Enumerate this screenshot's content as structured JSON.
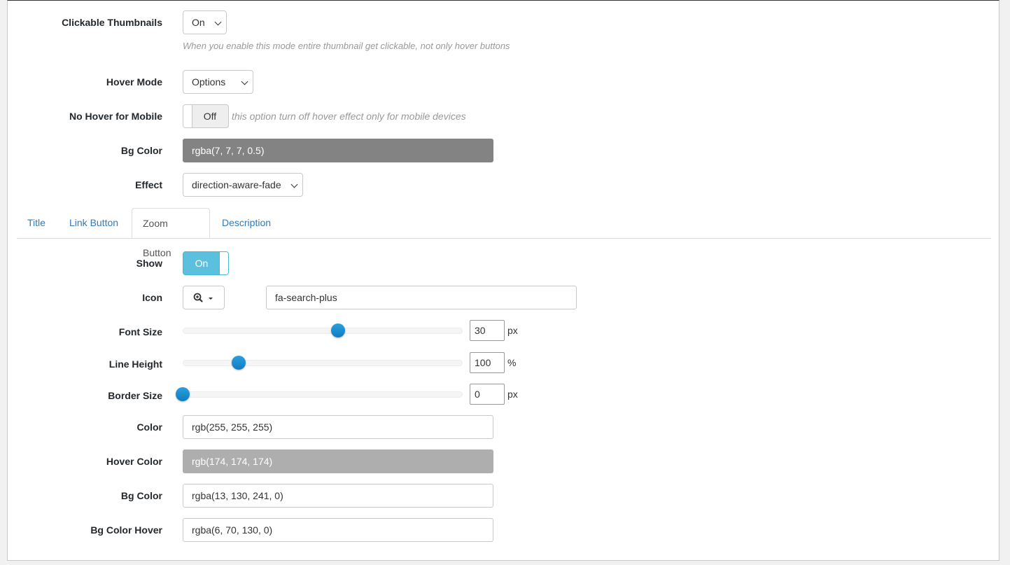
{
  "thumbnails": {
    "clickable_label": "Clickable Thumbnails",
    "clickable_value": "On",
    "clickable_hint": "When you enable this mode entire thumbnail get clickable, not only hover buttons",
    "hover_mode_label": "Hover Mode",
    "hover_mode_value": "Options",
    "no_hover_label": "No Hover for Mobile",
    "no_hover_value": "Off",
    "no_hover_hint": "this option turn off hover effect only for mobile devices",
    "bg_color_label": "Bg Color",
    "bg_color_value": "rgba(7, 7, 7, 0.5)",
    "effect_label": "Effect",
    "effect_value": "direction-aware-fade"
  },
  "tabs": [
    {
      "label": "Title",
      "active": false
    },
    {
      "label": "Link Button",
      "active": false
    },
    {
      "label": "Zoom Button",
      "active": true
    },
    {
      "label": "Description",
      "active": false
    }
  ],
  "zoom": {
    "show_label": "Show",
    "show_value": "On",
    "icon_label": "Icon",
    "icon_value": "fa-search-plus",
    "font_size_label": "Font Size",
    "font_size_value": "30",
    "font_size_unit": "px",
    "font_size_fraction": 0.555,
    "line_height_label": "Line Height",
    "line_height_value": "100",
    "line_height_unit": "%",
    "line_height_fraction": 0.2,
    "border_size_label": "Border Size",
    "border_size_value": "0",
    "border_size_unit": "px",
    "border_size_fraction": 0.0,
    "color_label": "Color",
    "color_value": "rgb(255, 255, 255)",
    "hover_color_label": "Hover Color",
    "hover_color_value": "rgb(174, 174, 174)",
    "bg_color_label": "Bg Color",
    "bg_color_value": "rgba(13, 130, 241, 0)",
    "bg_color_hover_label": "Bg Color Hover",
    "bg_color_hover_value": "rgba(6, 70, 130, 0)"
  },
  "colors": {
    "bg_swatch": "#838383",
    "hover_swatch": "#aeaeae",
    "toggle_on": "#5bc0de",
    "link": "#337ab7",
    "slider": "#1b8fd1"
  }
}
